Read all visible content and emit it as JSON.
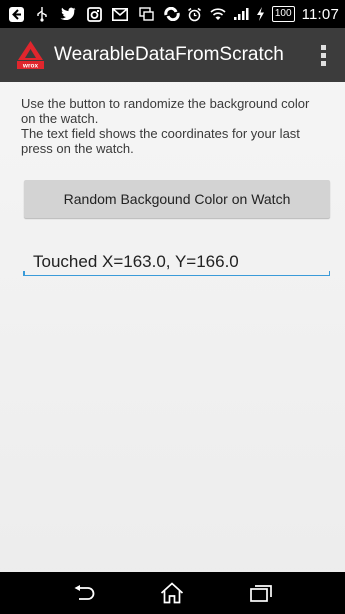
{
  "status_bar": {
    "icons": [
      "back-arrow-icon",
      "usb-icon",
      "twitter-icon",
      "instagram-icon",
      "gmail-icon",
      "screen-mirror-icon",
      "sync-icon",
      "alarm-icon",
      "wifi-icon",
      "signal-icon",
      "charging-icon"
    ],
    "battery_level": "100",
    "time": "11:07"
  },
  "action_bar": {
    "logo_icon": "wrox-logo-icon",
    "logo_text": "wrox",
    "title": "WearableDataFromScratch",
    "overflow_icon": "overflow-menu-icon"
  },
  "main": {
    "instructions": "Use the button to randomize the background color on the watch.\n The text field shows the coordinates for your last press on the watch.",
    "random_button_label": "Random Backgound Color on Watch",
    "touch_field_value": "Touched X=163.0, Y=166.0"
  },
  "nav_bar": {
    "back_icon": "back-icon",
    "home_icon": "home-icon",
    "recents_icon": "recents-icon"
  },
  "colors": {
    "status_bar": "#000000",
    "action_bar": "#3c3c3c",
    "background": "#f2f2f2",
    "button": "#d3d3d3",
    "field_underline": "#3a9bd9",
    "logo_red": "#e0262d"
  }
}
